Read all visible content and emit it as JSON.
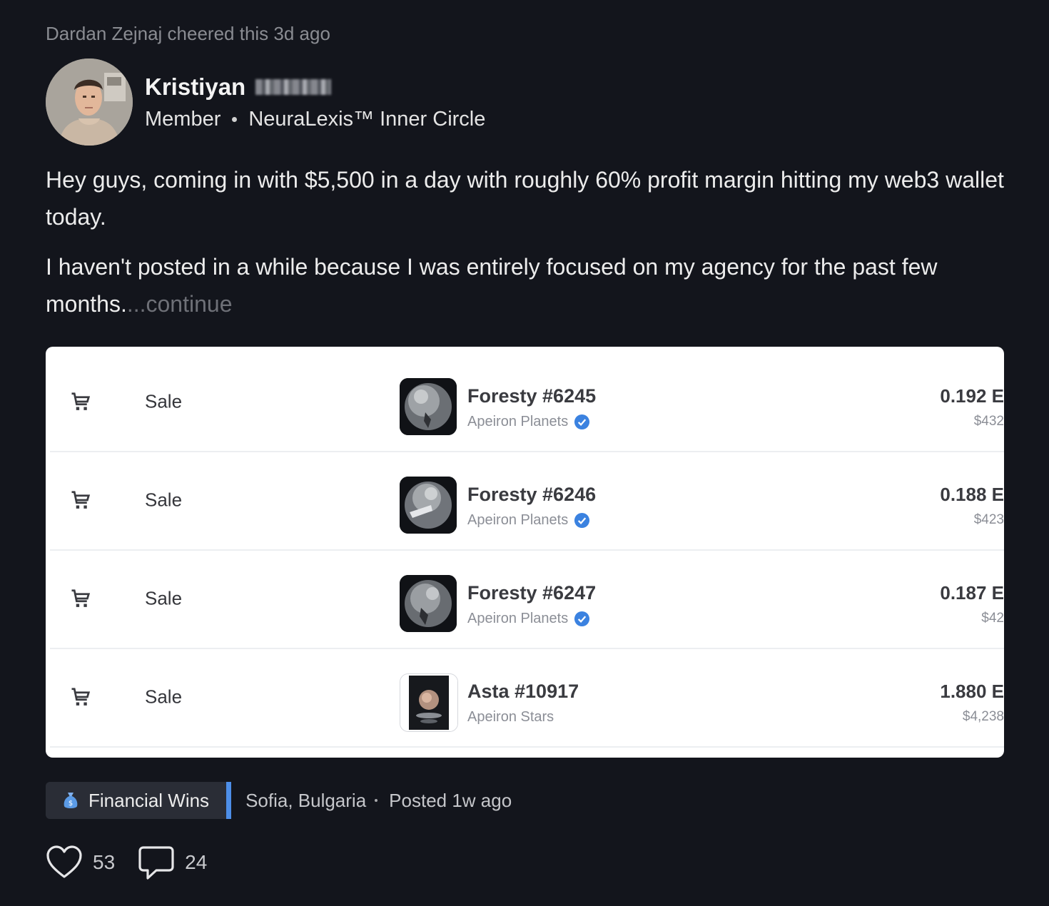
{
  "cheer_text": "Dardan Zejnaj cheered this 3d ago",
  "author": {
    "name": "Kristiyan",
    "role": "Member",
    "group": "NeuraLexis™ Inner Circle"
  },
  "post": {
    "paragraph_1": "Hey guys, coming in with $5,500 in a day with roughly 60% profit margin hitting my web3 wallet today.",
    "paragraph_2": "I haven't posted in a while because I was entirely focused on my agency for the past few months.",
    "continue_label": "...continue"
  },
  "sales": [
    {
      "event": "Sale",
      "item": "Foresty #6245",
      "collection": "Apeiron Planets",
      "verified": true,
      "price": "0.192 E",
      "usd": "$432"
    },
    {
      "event": "Sale",
      "item": "Foresty #6246",
      "collection": "Apeiron Planets",
      "verified": true,
      "price": "0.188 E",
      "usd": "$423"
    },
    {
      "event": "Sale",
      "item": "Foresty #6247",
      "collection": "Apeiron Planets",
      "verified": true,
      "price": "0.187 E",
      "usd": "$42"
    },
    {
      "event": "Sale",
      "item": "Asta #10917",
      "collection": "Apeiron Stars",
      "verified": false,
      "price": "1.880 E",
      "usd": "$4,238"
    }
  ],
  "category": {
    "label": "Financial Wins",
    "icon": "money-bag-icon",
    "accent": "#4d8ee8"
  },
  "location": "Sofia, Bulgaria",
  "posted": "Posted 1w ago",
  "likes": "53",
  "comments": "24",
  "colors": {
    "background": "#13151c",
    "muted_text": "#8a8c92",
    "verified_badge": "#3b82e0"
  }
}
